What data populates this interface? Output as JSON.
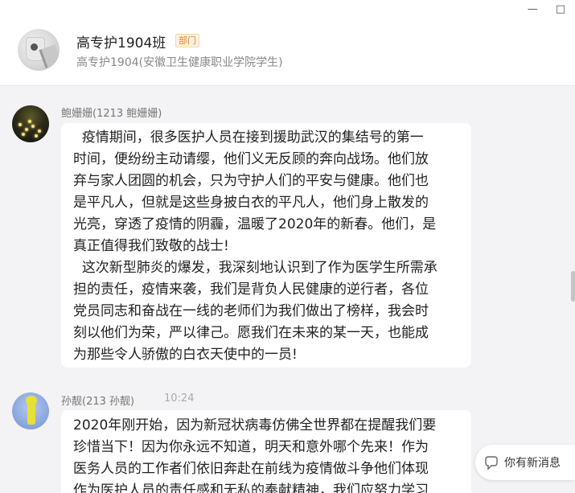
{
  "window": {
    "controls": [
      "—",
      "□"
    ]
  },
  "group": {
    "name": "高专护1904班",
    "badge": "部门",
    "subtitle": "高专护1904(安徽卫生健康职业学院学生)"
  },
  "messages": [
    {
      "sender": "鲍姗姗(1213 鲍姗姗)",
      "time": "",
      "text": "  疫情期间，很多医护人员在接到援助武汉的集结号的第一\n时间，便纷纷主动请缨，他们义无反顾的奔向战场。他们放\n弃与家人团圆的机会，只为守护人们的平安与健康。他们也\n是平凡人，但就是这些身披白衣的平凡人，他们身上散发的\n光亮，穿透了疫情的阴霾，温暖了2020年的新春。他们，是\n真正值得我们致敬的战士!\n  这次新型肺炎的爆发，我深刻地认识到了作为医学生所需承\n担的责任，疫情来袭，我们是背负人民健康的逆行者，各位\n党员同志和奋战在一线的老师们为我们做出了榜样，我会时\n刻以他们为荣，严以律己。愿我们在未来的某一天，也能成\n为那些令人骄傲的白衣天使中的一员!"
    },
    {
      "sender": "孙靓(213 孙靓)",
      "time": "10:24",
      "text": "2020年刚开始，因为新冠状病毒仿佛全世界都在提醒我们要\n珍惜当下！因为你永远不知道，明天和意外哪个先来！作为\n医务人员的工作者们依旧奔赴在前线为疫情做斗争他们体现\n作为医护人员的责任感和无私的奉献精神，我们应努力学习"
    }
  ],
  "toast": {
    "label": "你有新消息",
    "icon": "bubble-icon"
  }
}
